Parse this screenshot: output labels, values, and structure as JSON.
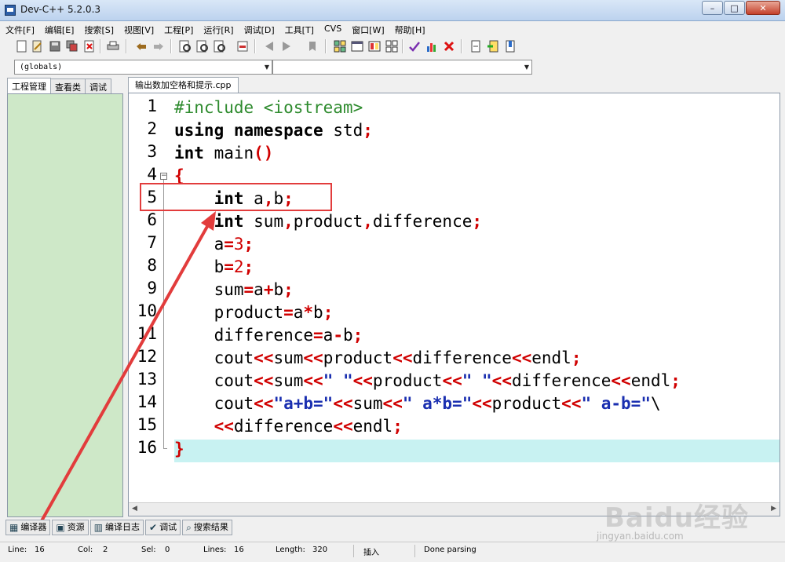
{
  "window": {
    "title": "Dev-C++ 5.2.0.3",
    "min_label": "–",
    "max_label": "□",
    "close_label": "✕"
  },
  "menu": [
    "文件[F]",
    "编辑[E]",
    "搜索[S]",
    "视图[V]",
    "工程[P]",
    "运行[R]",
    "调试[D]",
    "工具[T]",
    "CVS",
    "窗口[W]",
    "帮助[H]"
  ],
  "toolbar": {
    "icons": [
      "new-file-icon",
      "open-file-icon",
      "save-icon",
      "save-all-icon",
      "close-file-icon",
      "print-icon",
      "undo-icon",
      "redo-icon",
      "find-icon",
      "find-next-icon",
      "replace-icon",
      "goto-line-icon",
      "indent-icon",
      "unindent-icon",
      "toggle-bookmark-icon",
      "new-project-icon",
      "project-options-icon",
      "class-browser-icon",
      "layout-icon",
      "compile-icon",
      "chart-icon",
      "stop-icon",
      "insert-icon",
      "add-to-project-icon",
      "bookmark-icon"
    ]
  },
  "combos": {
    "globals": "(globals)",
    "members": ""
  },
  "left_tabs": [
    "工程管理",
    "查看类",
    "调试"
  ],
  "editor": {
    "file_tab": "输出数加空格和提示.cpp",
    "line_numbers": [
      "1",
      "2",
      "3",
      "4",
      "5",
      "6",
      "7",
      "8",
      "9",
      "10",
      "11",
      "12",
      "13",
      "14",
      "15",
      "16"
    ]
  },
  "bottom_tabs": [
    "编译器",
    "资源",
    "编译日志",
    "调试",
    "搜索结果"
  ],
  "status": {
    "line_label": "Line:",
    "line_value": "16",
    "col_label": "Col:",
    "col_value": "2",
    "sel_label": "Sel:",
    "sel_value": "0",
    "lines_label": "Lines:",
    "lines_value": "16",
    "length_label": "Length:",
    "length_value": "320",
    "mode": "插入",
    "message": "Done parsing"
  },
  "watermark": {
    "text": "Baidu经验",
    "sub": "jingyan.baidu.com"
  },
  "colors": {
    "annotation": "#e23c3c",
    "current_line": "#c8f2f2",
    "left_pane": "#cee8c8"
  }
}
